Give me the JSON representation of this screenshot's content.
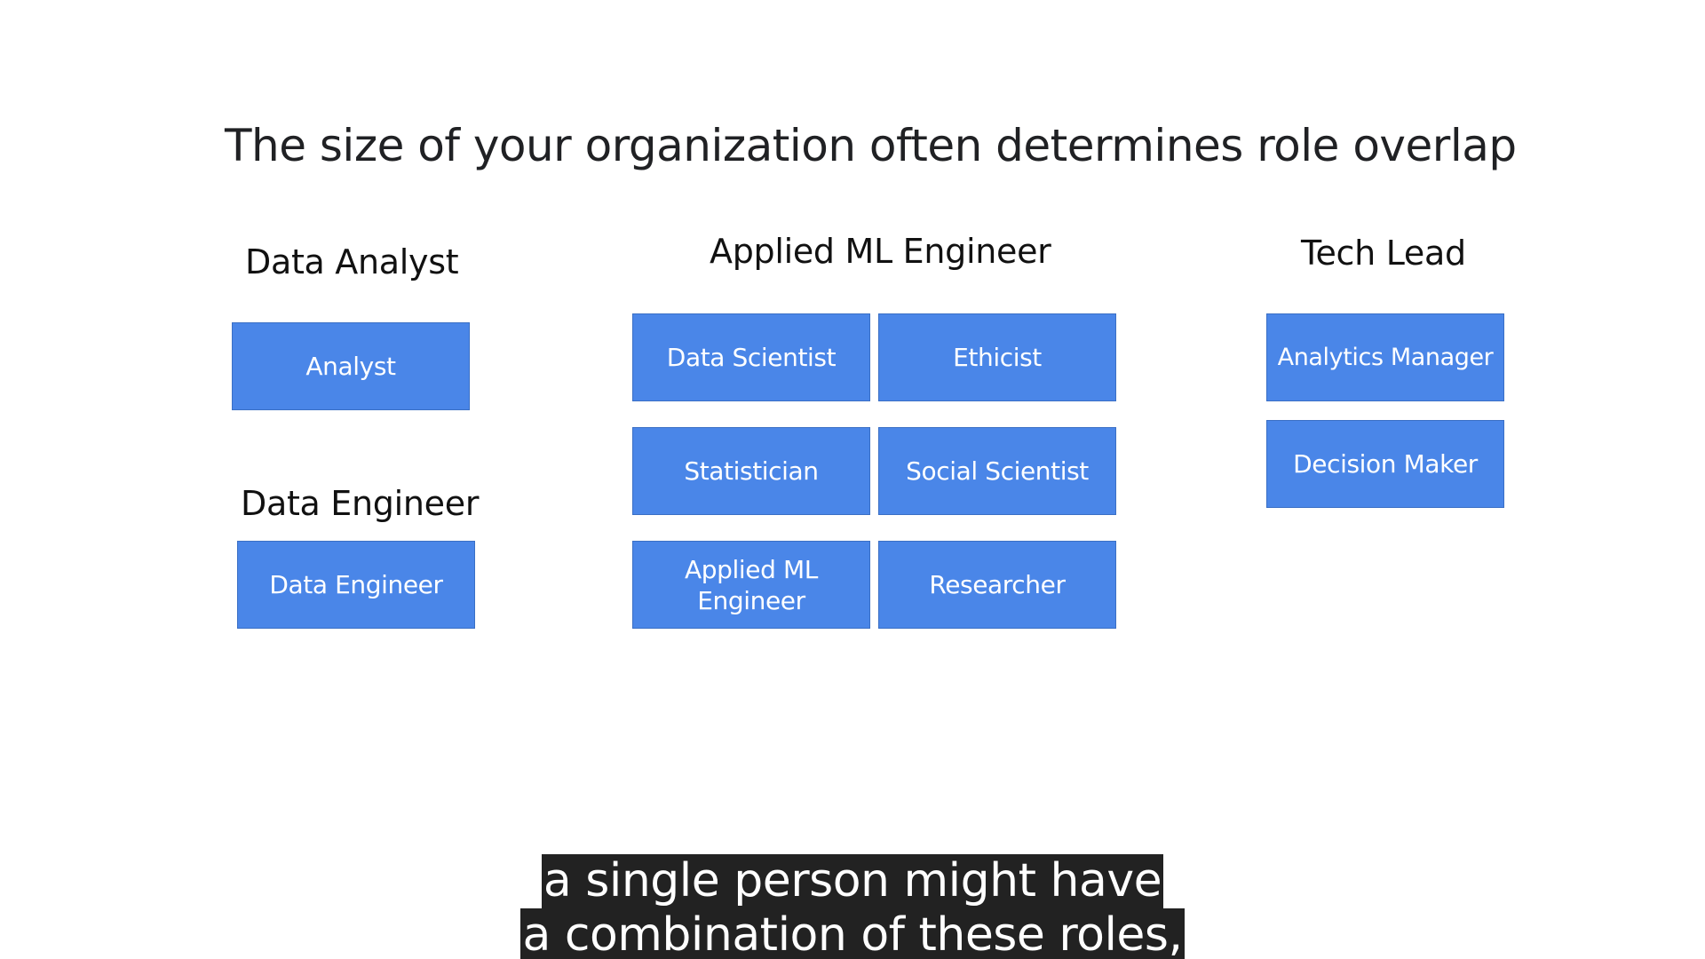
{
  "slide": {
    "title": "The size of your organization often determines role overlap"
  },
  "groups": {
    "data_analyst": {
      "heading": "Data Analyst",
      "roles": [
        "Analyst"
      ]
    },
    "data_engineer": {
      "heading": "Data Engineer",
      "roles": [
        "Data Engineer"
      ]
    },
    "applied_ml_engineer": {
      "heading": "Applied ML Engineer",
      "roles": [
        "Data Scientist",
        "Ethicist",
        "Statistician",
        "Social Scientist",
        "Applied ML Engineer",
        "Researcher"
      ]
    },
    "tech_lead": {
      "heading": "Tech Lead",
      "roles": [
        "Analytics Manager",
        "Decision Maker"
      ]
    }
  },
  "captions": {
    "line1": "a single person might have",
    "line2": "a combination of these roles,"
  },
  "colors": {
    "box_fill": "#4a86e8",
    "box_text": "#ffffff",
    "caption_bg": "#222222"
  }
}
